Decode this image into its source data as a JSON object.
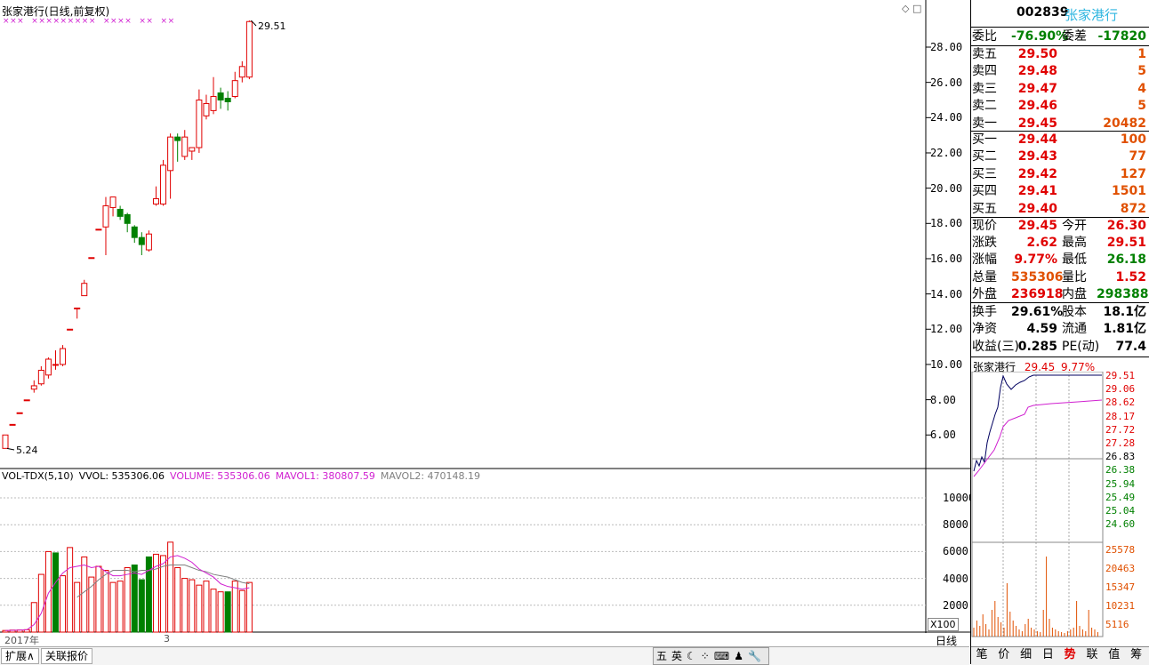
{
  "chart_header": {
    "title": "张家港行(日线,前复权)",
    "corner_buttons": "◇ □",
    "high_label": "29.51",
    "low_label": "5.24"
  },
  "price_axis": [
    "28.00",
    "26.00",
    "24.00",
    "22.00",
    "20.00",
    "18.00",
    "16.00",
    "14.00",
    "12.00",
    "10.00",
    "8.00",
    "6.00"
  ],
  "volume_header": {
    "name": "VOL-TDX(5,10)",
    "vvol": "VVOL: 535306.06",
    "volume": "VOLUME: 535306.06",
    "mavol1": "MAVOL1: 380807.59",
    "mavol2": "MAVOL2: 470148.19"
  },
  "volume_axis": [
    "10000",
    "8000",
    "6000",
    "4000",
    "2000"
  ],
  "volume_unit": "X100",
  "x_labels": {
    "year": "2017年",
    "month": "3"
  },
  "period_button": "日线",
  "bottom_tabs": [
    "扩展∧",
    "关联报价"
  ],
  "ime_bar": [
    "五",
    "英",
    "☾",
    "⁘",
    "⌨",
    "♟",
    "🔧"
  ],
  "quote": {
    "code": "002839",
    "name": "张家港行",
    "weibi_label": "委比",
    "weibi": "-76.90%",
    "weicha_label": "委差",
    "weicha": "-17820",
    "asks": [
      {
        "label": "卖五",
        "price": "29.50",
        "vol": "1"
      },
      {
        "label": "卖四",
        "price": "29.48",
        "vol": "5"
      },
      {
        "label": "卖三",
        "price": "29.47",
        "vol": "4"
      },
      {
        "label": "卖二",
        "price": "29.46",
        "vol": "5"
      },
      {
        "label": "卖一",
        "price": "29.45",
        "vol": "20482"
      }
    ],
    "bids": [
      {
        "label": "买一",
        "price": "29.44",
        "vol": "100"
      },
      {
        "label": "买二",
        "price": "29.43",
        "vol": "77"
      },
      {
        "label": "买三",
        "price": "29.42",
        "vol": "127"
      },
      {
        "label": "买四",
        "price": "29.41",
        "vol": "1501"
      },
      {
        "label": "买五",
        "price": "29.40",
        "vol": "872"
      }
    ],
    "stats1": [
      {
        "l1": "现价",
        "v1": "29.45",
        "l2": "今开",
        "v2": "26.30"
      },
      {
        "l1": "涨跌",
        "v1": "2.62",
        "l2": "最高",
        "v2": "29.51"
      },
      {
        "l1": "涨幅",
        "v1": "9.77%",
        "l2": "最低",
        "v2": "26.18"
      },
      {
        "l1": "总量",
        "v1": "535306",
        "l2": "量比",
        "v2": "1.52"
      },
      {
        "l1": "外盘",
        "v1": "236918",
        "l2": "内盘",
        "v2": "298388"
      }
    ],
    "stats2": [
      {
        "l1": "换手",
        "v1": "29.61%",
        "l2": "股本",
        "v2": "18.1亿"
      },
      {
        "l1": "净资",
        "v1": "4.59",
        "l2": "流通",
        "v2": "1.81亿"
      },
      {
        "l1": "收益(三)",
        "v1": "0.285",
        "l2": "PE(动)",
        "v2": "77.4"
      }
    ]
  },
  "mini_chart": {
    "title_name": "张家港行",
    "title_price": "29.45",
    "title_pct": "9.77%",
    "price_labels": [
      "29.51",
      "29.06",
      "28.62",
      "28.17",
      "27.72",
      "27.28",
      "26.83",
      "26.38",
      "25.94",
      "25.49",
      "25.04",
      "24.60"
    ],
    "vol_labels": [
      "25578",
      "20463",
      "15347",
      "10231",
      "5116"
    ]
  },
  "right_tabs": [
    "笔",
    "价",
    "细",
    "日",
    "势",
    "联",
    "值",
    "筹"
  ],
  "colors": {
    "up": "#e00000",
    "down": "#008000",
    "ma1": "#d020d0",
    "ma2": "#808080",
    "accent": "#2fb6e0"
  },
  "chart_data": {
    "type": "candlestick",
    "title": "张家港行(日线,前复权)",
    "ylim": [
      4.5,
      30
    ],
    "candles": [
      {
        "o": 5.24,
        "h": 6.0,
        "l": 5.24,
        "c": 6.0
      },
      {
        "o": 6.6,
        "h": 6.6,
        "l": 6.6,
        "c": 6.6
      },
      {
        "o": 7.26,
        "h": 7.26,
        "l": 7.26,
        "c": 7.26
      },
      {
        "o": 7.99,
        "h": 7.99,
        "l": 7.99,
        "c": 7.99
      },
      {
        "o": 8.6,
        "h": 9.1,
        "l": 8.4,
        "c": 8.79
      },
      {
        "o": 8.9,
        "h": 9.9,
        "l": 8.8,
        "c": 9.67
      },
      {
        "o": 9.4,
        "h": 10.4,
        "l": 9.2,
        "c": 10.3
      },
      {
        "o": 10.0,
        "h": 10.8,
        "l": 9.7,
        "c": 10.0
      },
      {
        "o": 10.0,
        "h": 11.1,
        "l": 9.9,
        "c": 10.9
      },
      {
        "o": 12.0,
        "h": 12.0,
        "l": 12.0,
        "c": 12.0
      },
      {
        "o": 13.2,
        "h": 13.2,
        "l": 12.6,
        "c": 13.2
      },
      {
        "o": 13.9,
        "h": 14.8,
        "l": 13.9,
        "c": 14.6
      },
      {
        "o": 16.06,
        "h": 16.06,
        "l": 16.06,
        "c": 16.06
      },
      {
        "o": 17.67,
        "h": 17.67,
        "l": 17.67,
        "c": 17.67
      },
      {
        "o": 17.8,
        "h": 19.5,
        "l": 16.2,
        "c": 19.0
      },
      {
        "o": 18.9,
        "h": 19.5,
        "l": 18.4,
        "c": 19.5
      },
      {
        "o": 18.8,
        "h": 19.0,
        "l": 18.2,
        "c": 18.4
      },
      {
        "o": 18.5,
        "h": 18.6,
        "l": 17.5,
        "c": 18.0
      },
      {
        "o": 17.8,
        "h": 17.9,
        "l": 16.9,
        "c": 17.2
      },
      {
        "o": 17.2,
        "h": 17.5,
        "l": 16.2,
        "c": 16.8
      },
      {
        "o": 16.5,
        "h": 17.6,
        "l": 16.4,
        "c": 17.4
      },
      {
        "o": 19.1,
        "h": 20.1,
        "l": 19.0,
        "c": 19.4
      },
      {
        "o": 19.1,
        "h": 21.6,
        "l": 19.0,
        "c": 21.3
      },
      {
        "o": 21.0,
        "h": 23.1,
        "l": 19.4,
        "c": 22.9
      },
      {
        "o": 22.9,
        "h": 23.1,
        "l": 21.5,
        "c": 22.7
      },
      {
        "o": 21.8,
        "h": 23.3,
        "l": 21.6,
        "c": 22.9
      },
      {
        "o": 22.1,
        "h": 22.3,
        "l": 21.6,
        "c": 22.3
      },
      {
        "o": 22.3,
        "h": 25.6,
        "l": 22.0,
        "c": 25.0
      },
      {
        "o": 24.1,
        "h": 25.3,
        "l": 23.9,
        "c": 24.8
      },
      {
        "o": 24.4,
        "h": 26.3,
        "l": 24.2,
        "c": 25.2
      },
      {
        "o": 25.4,
        "h": 25.7,
        "l": 24.5,
        "c": 25.0
      },
      {
        "o": 25.1,
        "h": 25.5,
        "l": 24.4,
        "c": 24.9
      },
      {
        "o": 25.2,
        "h": 26.6,
        "l": 25.1,
        "c": 26.1
      },
      {
        "o": 26.3,
        "h": 27.2,
        "l": 26.0,
        "c": 26.9
      },
      {
        "o": 26.3,
        "h": 29.51,
        "l": 26.18,
        "c": 29.45
      }
    ],
    "volume_ylim": [
      0,
      12000
    ],
    "volumes": [
      120,
      150,
      160,
      180,
      2200,
      4300,
      6000,
      5900,
      4200,
      6300,
      3700,
      5600,
      4100,
      4900,
      4600,
      3700,
      3800,
      4800,
      5000,
      3900,
      5600,
      5800,
      5700,
      6700,
      4800,
      4000,
      3900,
      3500,
      3800,
      3200,
      3000,
      3000,
      3800,
      3100,
      3700
    ],
    "volume_down": [
      7,
      18,
      19,
      20,
      31
    ],
    "mavol1": [
      120,
      130,
      150,
      170,
      560,
      1400,
      2900,
      3700,
      4400,
      4800,
      4900,
      5000,
      4800,
      4900,
      4500,
      4200,
      4200,
      4300,
      4400,
      4300,
      4600,
      4900,
      5100,
      5600,
      5700,
      5500,
      5200,
      4700,
      4400,
      4100,
      3600,
      3400,
      3300,
      3200,
      3300
    ],
    "mavol2": [
      null,
      null,
      null,
      null,
      null,
      null,
      null,
      null,
      null,
      null,
      2600,
      3000,
      3400,
      3900,
      4300,
      4600,
      4600,
      4600,
      4500,
      4600,
      4600,
      4700,
      4900,
      5000,
      5000,
      5000,
      4800,
      4600,
      4500,
      4300,
      4200,
      4100,
      3900,
      3700,
      3600
    ],
    "ma_markers": [
      0,
      1,
      2,
      4,
      5,
      6,
      7,
      8,
      9,
      10,
      11,
      12,
      14,
      15,
      16,
      17,
      19,
      20,
      22,
      23
    ]
  }
}
